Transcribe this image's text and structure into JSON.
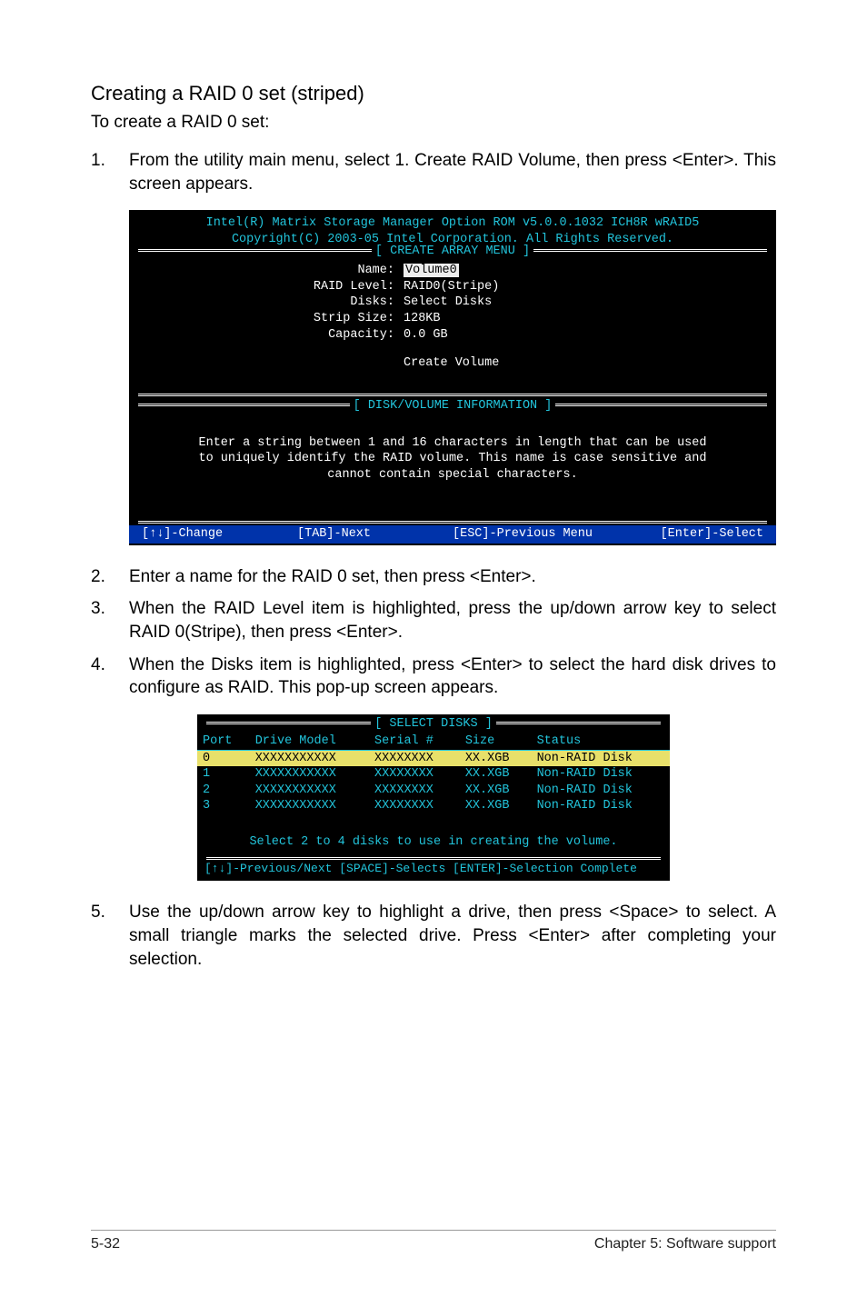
{
  "heading": "Creating a RAID 0 set (striped)",
  "subheading": "To create a RAID 0 set:",
  "steps": {
    "s1": {
      "num": "1.",
      "text": "From the utility main menu, select 1. Create RAID Volume, then press <Enter>. This screen appears."
    },
    "s2": {
      "num": "2.",
      "text": "Enter a name for the RAID 0 set, then press <Enter>."
    },
    "s3": {
      "num": "3.",
      "text": "When the RAID Level item is highlighted, press the up/down arrow key to select RAID 0(Stripe), then press <Enter>."
    },
    "s4": {
      "num": "4.",
      "text": "When the Disks item is highlighted, press <Enter> to select the hard disk drives to configure as RAID. This pop-up screen appears."
    },
    "s5": {
      "num": "5.",
      "text": "Use the up/down arrow key to highlight a drive, then press <Space>  to select. A small triangle marks the selected drive. Press <Enter> after completing your selection."
    }
  },
  "terminal1": {
    "title1": "Intel(R) Matrix Storage Manager Option ROM v5.0.0.1032 ICH8R wRAID5",
    "title2": "Copyright(C) 2003-05 Intel Corporation. All Rights Reserved.",
    "section1": "[ CREATE ARRAY MENU ]",
    "fields": {
      "name_label": "Name:",
      "name_val": "Volume0",
      "raid_label": "RAID Level:",
      "raid_val": "RAID0(Stripe)",
      "disks_label": "Disks:",
      "disks_val": "Select Disks",
      "strip_label": "Strip Size:",
      "strip_val": "128KB",
      "cap_label": "Capacity:",
      "cap_val": "0.0   GB"
    },
    "create": "Create Volume",
    "section2": "[ DISK/VOLUME INFORMATION ]",
    "hint1": "Enter a string between 1 and 16 characters in length that can be used",
    "hint2": "to uniquely identify the RAID volume. This name is case sensitive and",
    "hint3": "cannot contain special characters.",
    "footer": {
      "f1": "[↑↓]-Change",
      "f2": "[TAB]-Next",
      "f3": "[ESC]-Previous Menu",
      "f4": "[Enter]-Select"
    }
  },
  "terminal2": {
    "section": "[ SELECT DISKS ]",
    "headers": {
      "port": "Port",
      "model": "Drive Model",
      "serial": "Serial #",
      "size": "Size",
      "status": "Status"
    },
    "rows": [
      {
        "port": "0",
        "model": "XXXXXXXXXXX",
        "serial": "XXXXXXXX",
        "size": "XX.XGB",
        "status": "Non-RAID Disk",
        "selected": true
      },
      {
        "port": "1",
        "model": "XXXXXXXXXXX",
        "serial": "XXXXXXXX",
        "size": "XX.XGB",
        "status": "Non-RAID Disk",
        "selected": false
      },
      {
        "port": "2",
        "model": "XXXXXXXXXXX",
        "serial": "XXXXXXXX",
        "size": "XX.XGB",
        "status": "Non-RAID Disk",
        "selected": false
      },
      {
        "port": "3",
        "model": "XXXXXXXXXXX",
        "serial": "XXXXXXXX",
        "size": "XX.XGB",
        "status": "Non-RAID Disk",
        "selected": false
      }
    ],
    "hint": "Select 2 to 4 disks to use in creating the volume.",
    "footer": "[↑↓]-Previous/Next  [SPACE]-Selects  [ENTER]-Selection Complete"
  },
  "pagefooter": {
    "left": "5-32",
    "right": "Chapter 5: Software support"
  }
}
